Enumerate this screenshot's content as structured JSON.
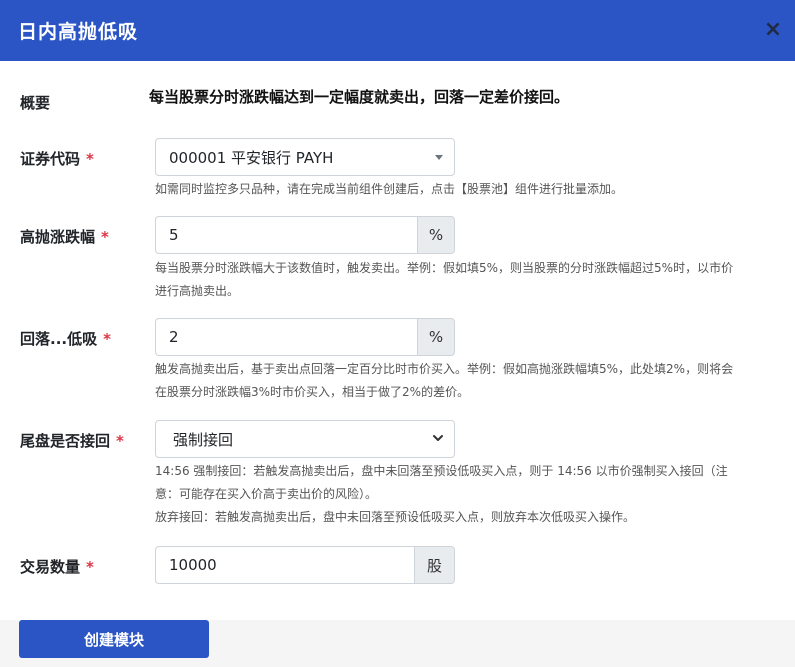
{
  "dialog": {
    "title": "日内高抛低吸",
    "close_icon": "×"
  },
  "summary": {
    "label": "概要",
    "text": "每当股票分时涨跌幅达到一定幅度就卖出，回落一定差价接回。"
  },
  "security": {
    "label": "证券代码",
    "required": "*",
    "value": "000001 平安银行 PAYH",
    "help": "如需同时监控多只品种，请在完成当前组件创建后，点击【股票池】组件进行批量添加。"
  },
  "high_sell": {
    "label": "高抛涨跌幅",
    "required": "*",
    "value": "5",
    "unit": "%",
    "help_line1": "每当股票分时涨跌幅大于该数值时，触发卖出。举例：假如填5%，则当股票的分时涨跌幅超过5%时，以市价",
    "help_line2": "进行高抛卖出。"
  },
  "low_buy": {
    "label": "回落...低吸",
    "required": "*",
    "value": "2",
    "unit": "%",
    "help_line1": "触发高抛卖出后，基于卖出点回落一定百分比时市价买入。举例：假如高抛涨跌幅填5%，此处填2%，则将会",
    "help_line2": "在股票分时涨跌幅3%时市价买入，相当于做了2%的差价。"
  },
  "close_buyback": {
    "label": "尾盘是否接回",
    "required": "*",
    "selected": "强制接回",
    "help_line1": "14:56 强制接回：若触发高抛卖出后，盘中未回落至预设低吸买入点，则于 14:56 以市价强制买入接回（注",
    "help_line2": "意：可能存在买入价高于卖出价的风险）。",
    "help_line3": "放弃接回：若触发高抛卖出后，盘中未回落至预设低吸买入点，则放弃本次低吸买入操作。"
  },
  "quantity": {
    "label": "交易数量",
    "required": "*",
    "value": "10000",
    "unit": "股"
  },
  "footer": {
    "submit_label": "创建模块"
  },
  "colors": {
    "header": "#2b55c4",
    "required": "#dc3545",
    "addon_bg": "#e9ecef"
  }
}
